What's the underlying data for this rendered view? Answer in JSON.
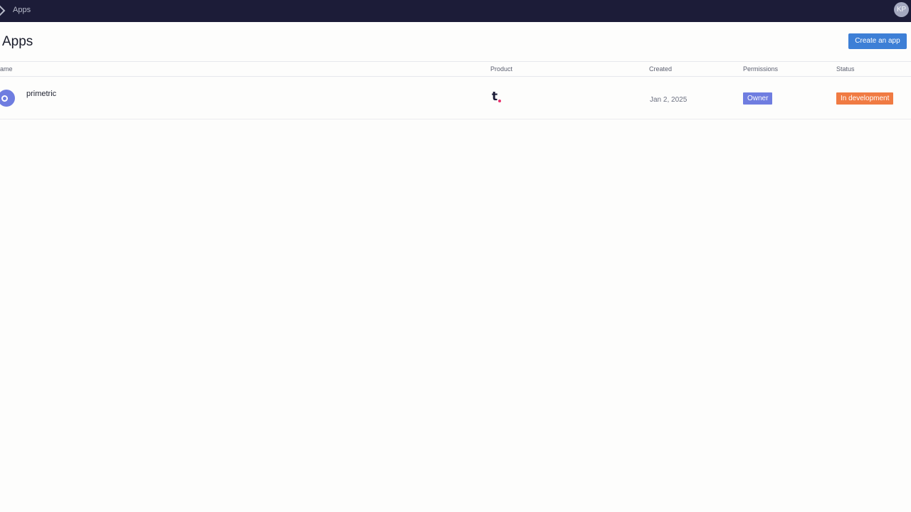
{
  "topbar": {
    "breadcrumb": "Apps",
    "avatar_initials": "KP"
  },
  "page": {
    "title": "Apps",
    "create_button_label": "Create an app"
  },
  "table": {
    "columns": {
      "name": "ame",
      "product": "Product",
      "created": "Created",
      "permissions": "Permissions",
      "status": "Status"
    },
    "rows": [
      {
        "name": "primetric",
        "product_icon": "t-logo-icon",
        "created": "Jan 2, 2025",
        "permissions": "Owner",
        "status": "In development"
      }
    ]
  },
  "colors": {
    "topbar_bg": "#1c1c38",
    "primary_button": "#3d7fd6",
    "permission_badge": "#6f7de0",
    "status_badge": "#f07b43",
    "logo_dot": "#e8336d"
  }
}
